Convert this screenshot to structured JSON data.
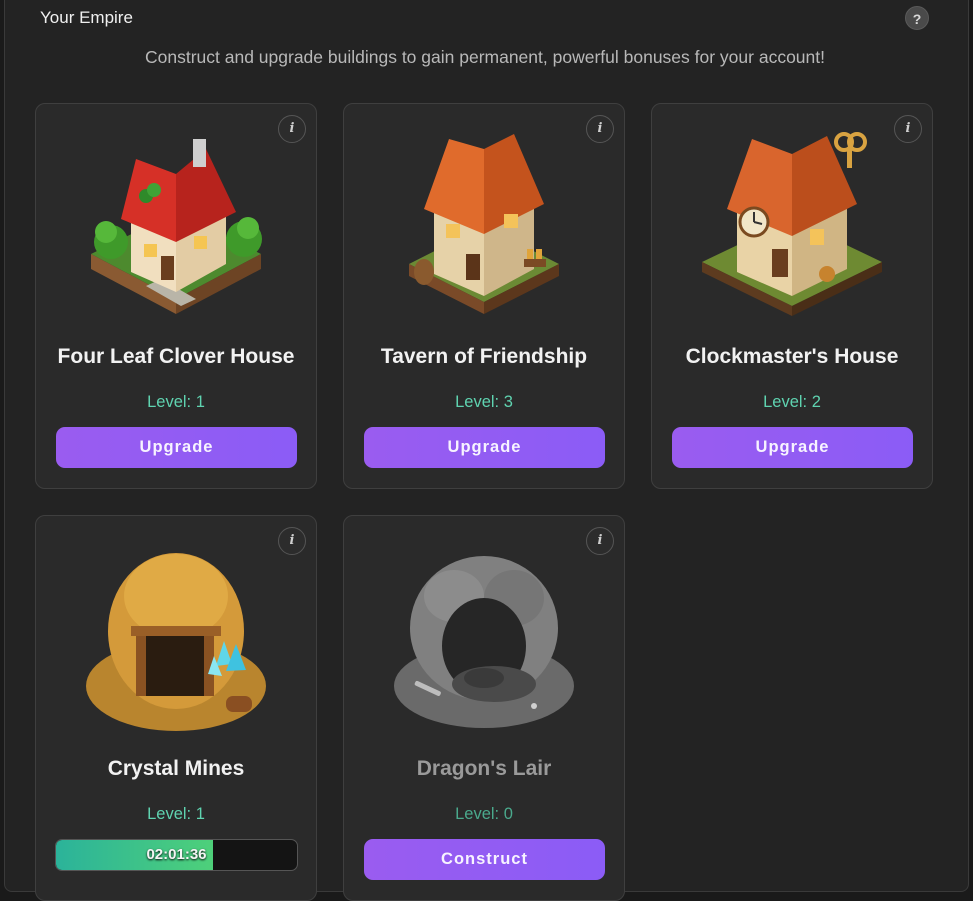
{
  "header": {
    "title": "Your Empire",
    "help_label": "?",
    "subtitle": "Construct and upgrade buildings to gain permanent, powerful bonuses for your account!"
  },
  "info_label": "i",
  "buildings": [
    {
      "name": "Four Leaf Clover House",
      "level": "Level: 1",
      "action": "Upgrade"
    },
    {
      "name": "Tavern of Friendship",
      "level": "Level: 3",
      "action": "Upgrade"
    },
    {
      "name": "Clockmaster's House",
      "level": "Level: 2",
      "action": "Upgrade"
    },
    {
      "name": "Crystal Mines",
      "level": "Level: 1",
      "timer": "02:01:36",
      "progress": 0.65
    },
    {
      "name": "Dragon's Lair",
      "level": "Level: 0",
      "action": "Construct"
    }
  ],
  "colors": {
    "accent": "#8b5cf6",
    "level_text": "#5fd3b0",
    "progress": "#3cc489"
  }
}
